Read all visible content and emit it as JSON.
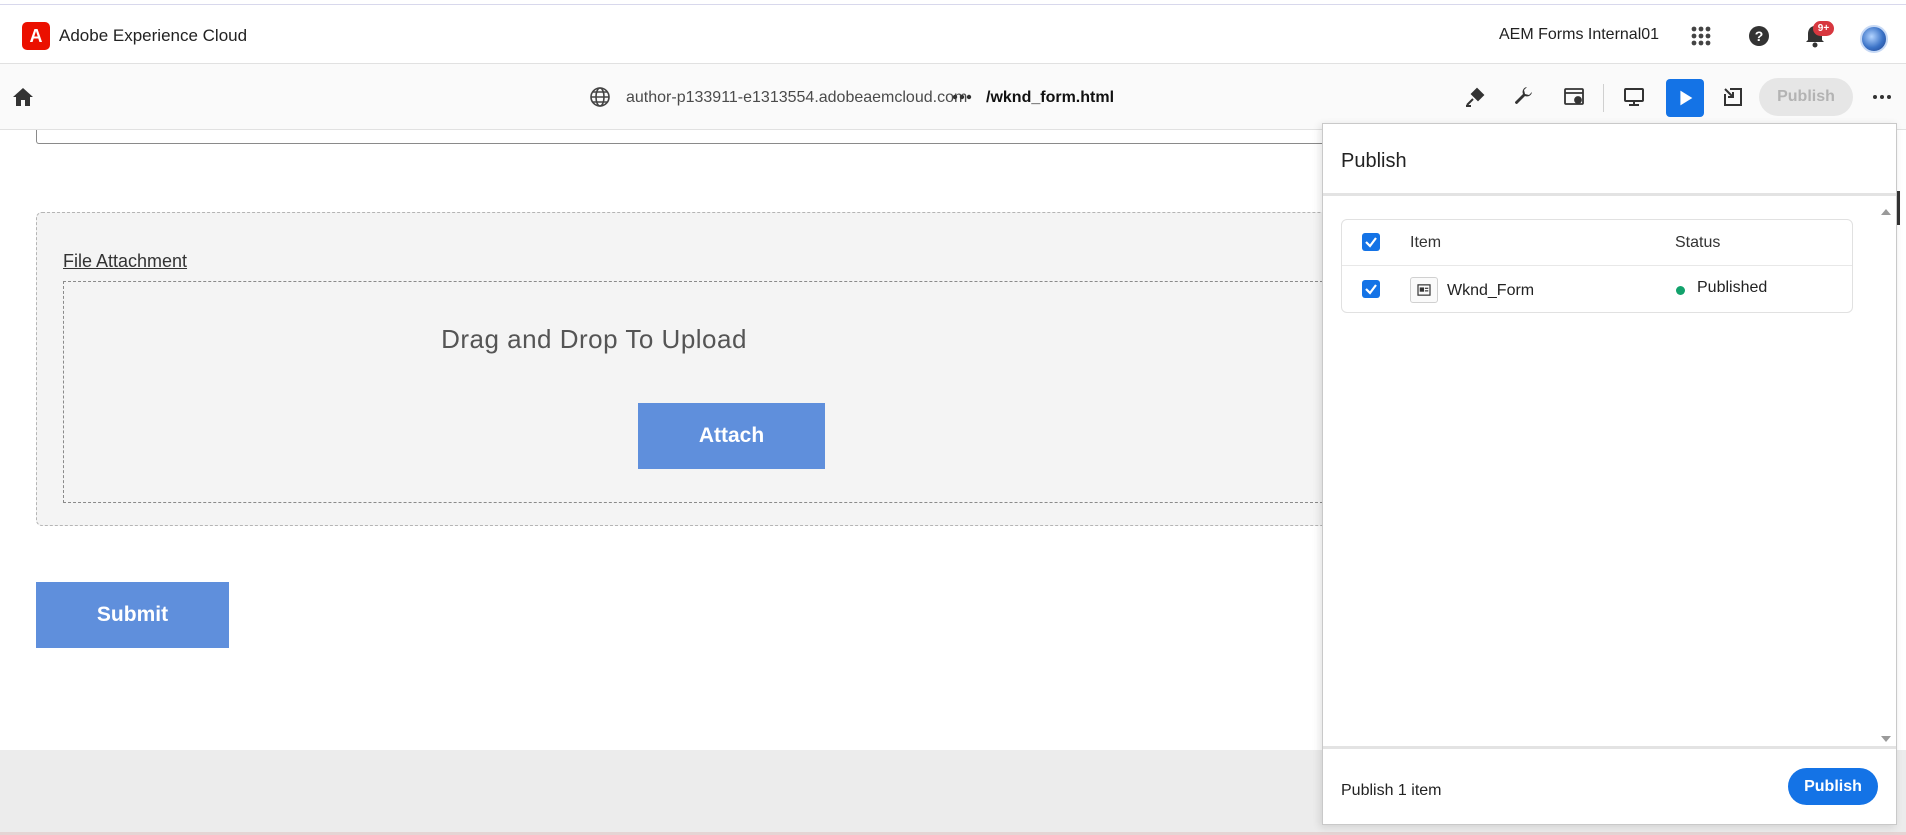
{
  "shell": {
    "title": "Adobe Experience Cloud",
    "org": "AEM Forms Internal01",
    "notification_count": "9+",
    "icons": [
      "app-switcher-icon",
      "help-icon",
      "bell-icon"
    ],
    "brand_color": "#eb1000"
  },
  "toolbar": {
    "host": "author-p133911-e1313554.adobeaemcloud.com",
    "path": "/wknd_form.html",
    "more_label": "•••",
    "publish_label": "Publish",
    "icons": [
      "home-icon",
      "globe-icon",
      "edit-icon",
      "wrench-icon",
      "page-settings-icon",
      "desktop-icon",
      "preview-play-icon",
      "open-external-icon",
      "more-icon"
    ]
  },
  "form": {
    "file_attachment_label": "File Attachment",
    "drop_text": "Drag and Drop To Upload",
    "attach_label": "Attach",
    "submit_label": "Submit",
    "button_color": "#5f8fdc"
  },
  "publish_panel": {
    "title": "Publish",
    "columns": {
      "item": "Item",
      "status": "Status"
    },
    "rows": [
      {
        "name": "Wknd_Form",
        "status": "Published",
        "checked": true,
        "status_color": "#12a26c"
      }
    ],
    "count_label": "Publish 1 item",
    "publish_label": "Publish",
    "accent": "#1473e6"
  }
}
